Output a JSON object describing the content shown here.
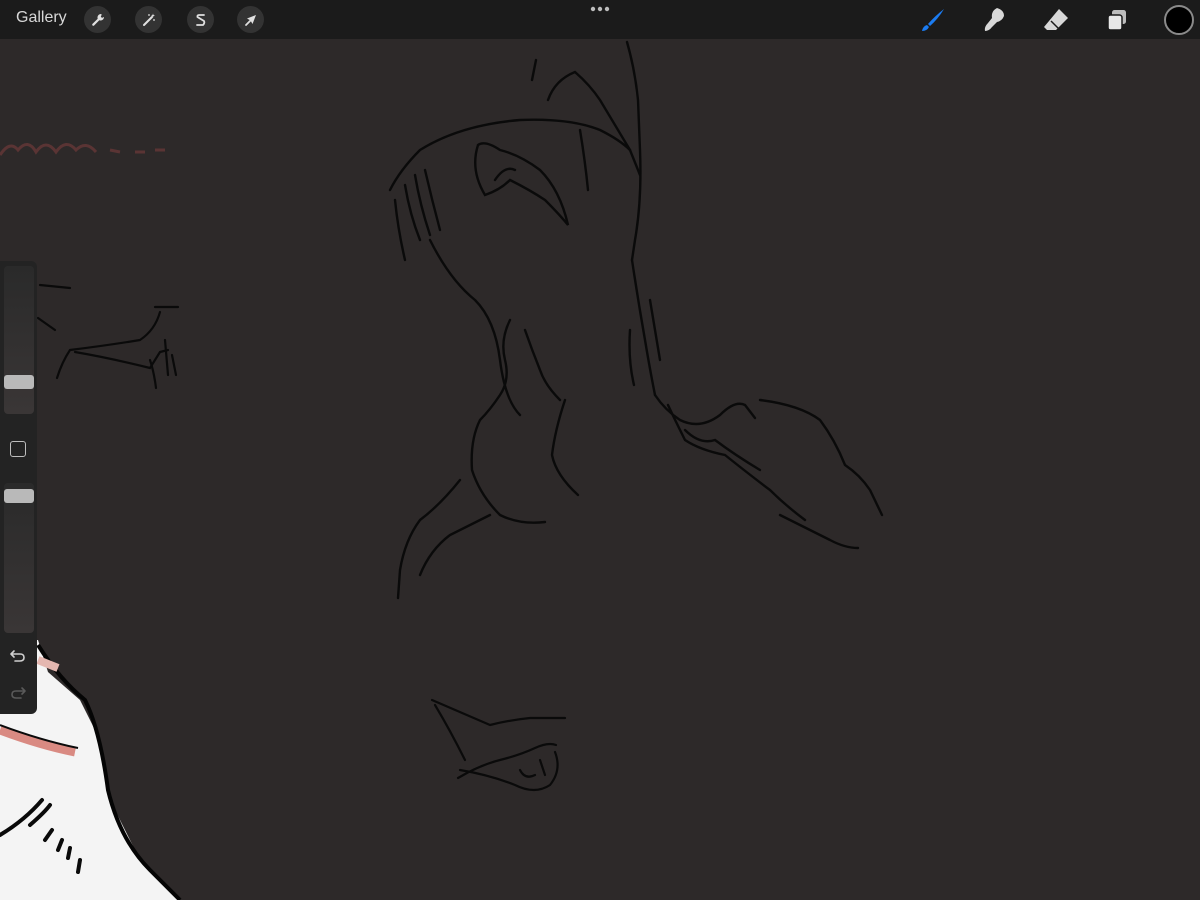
{
  "toolbar": {
    "gallery_label": "Gallery",
    "left_tools": [
      {
        "name": "actions",
        "icon": "wrench-icon"
      },
      {
        "name": "adjustments",
        "icon": "magic-wand-icon"
      },
      {
        "name": "selection",
        "icon": "selection-s-icon"
      },
      {
        "name": "transform",
        "icon": "arrow-cursor-icon"
      }
    ],
    "more_icon": "ellipsis-icon",
    "right_tools": [
      {
        "name": "brush",
        "icon": "brush-icon",
        "active": true
      },
      {
        "name": "smudge",
        "icon": "smudge-icon",
        "active": false
      },
      {
        "name": "eraser",
        "icon": "eraser-icon",
        "active": false
      },
      {
        "name": "layers",
        "icon": "layers-icon",
        "active": false
      }
    ],
    "current_color": "#000000",
    "accent_color": "#1b7cf2"
  },
  "sidebar": {
    "brush_size_icon": "slider-icon",
    "modify_icon": "square-button-icon",
    "opacity_icon": "slider-icon",
    "undo_icon": "undo-icon",
    "redo_icon": "redo-icon",
    "redo_enabled": false
  },
  "canvas": {
    "background_color": "#2d2929",
    "stroke_color": "#0a0a0a"
  }
}
